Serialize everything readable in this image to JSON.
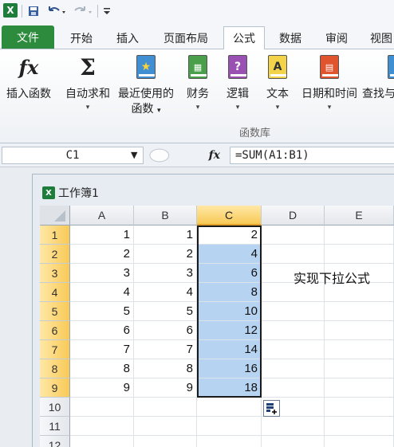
{
  "qat": {
    "logo": "X",
    "save_icon": "save-icon",
    "undo_icon": "undo-icon",
    "redo_icon": "redo-icon",
    "customize_icon": "customize-icon"
  },
  "tabs": {
    "file": "文件",
    "home": "开始",
    "insert": "插入",
    "page_layout": "页面布局",
    "formulas": "公式",
    "data": "数据",
    "review": "审阅",
    "view": "视图"
  },
  "ribbon": {
    "insert_function": "插入函数",
    "autosum": "自动求和",
    "recently_used_1": "最近使用的",
    "recently_used_2": "函数",
    "financial": "财务",
    "logical": "逻辑",
    "text": "文本",
    "datetime": "日期和时间",
    "lookup": "查找与",
    "group_label": "函数库",
    "fx_glyph": "fx",
    "sigma_glyph": "Σ",
    "dropdown_glyph": "▾"
  },
  "formula_bar": {
    "name_box": "C1",
    "fx": "fx",
    "formula": "=SUM(A1:B1)"
  },
  "workbook": {
    "title": "工作簿1",
    "icon": "X"
  },
  "sheet": {
    "columns": [
      "A",
      "B",
      "C",
      "D",
      "E"
    ],
    "rows": [
      "1",
      "2",
      "3",
      "4",
      "5",
      "6",
      "7",
      "8",
      "9",
      "10",
      "11",
      "12"
    ],
    "colA": [
      "1",
      "2",
      "3",
      "4",
      "5",
      "6",
      "7",
      "8",
      "9"
    ],
    "colB": [
      "1",
      "2",
      "3",
      "4",
      "5",
      "6",
      "7",
      "8",
      "9"
    ],
    "colC": [
      "2",
      "4",
      "6",
      "8",
      "10",
      "12",
      "14",
      "16",
      "18"
    ],
    "note": "实现下拉公式",
    "selected_column": "C",
    "selected_rows": [
      "1",
      "2",
      "3",
      "4",
      "5",
      "6",
      "7",
      "8",
      "9"
    ]
  },
  "colors": {
    "file_tab": "#2c8b3c",
    "selection_fill": "#b6d4f2",
    "header_highlight": "#f8c956"
  }
}
